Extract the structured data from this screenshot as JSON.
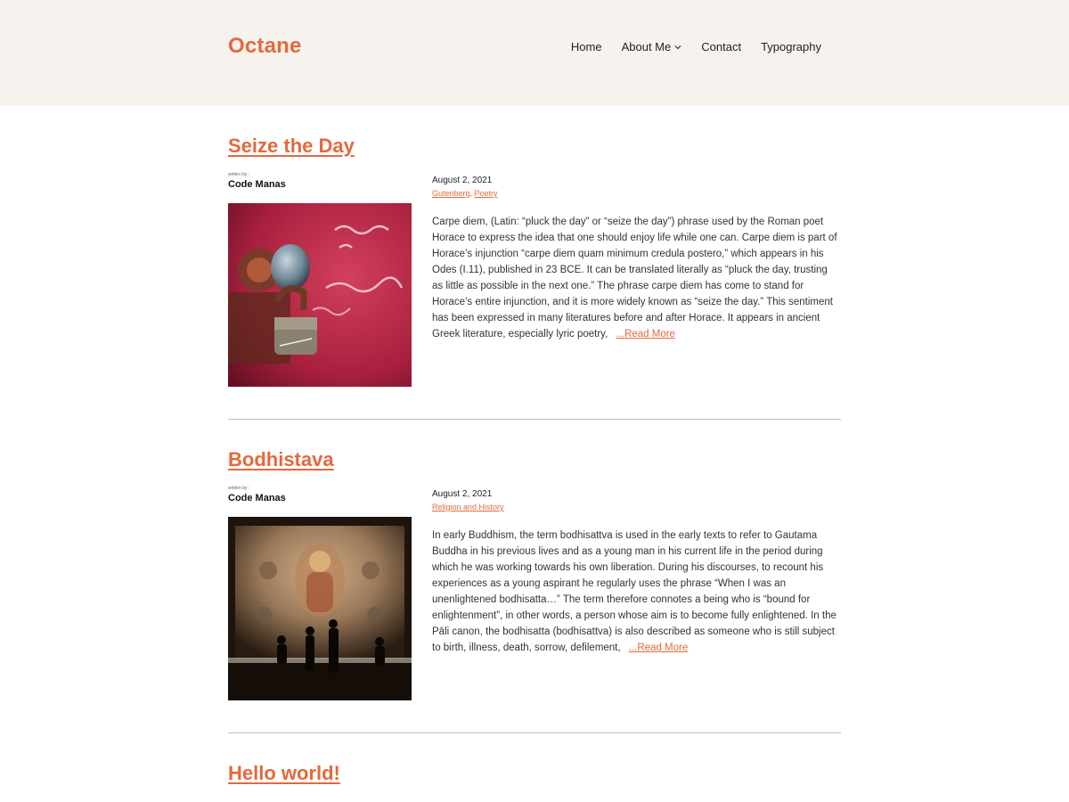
{
  "site": {
    "title": "Octane"
  },
  "nav": {
    "items": [
      {
        "label": "Home"
      },
      {
        "label": "About Me"
      },
      {
        "label": "Contact"
      },
      {
        "label": "Typography"
      }
    ]
  },
  "posts": [
    {
      "title": "Seize the Day",
      "written_by": "written by :",
      "author": "Code Manas",
      "date": "August 2, 2021",
      "categories": [
        "Gutenberg",
        "Poetry"
      ],
      "excerpt": "Carpe diem, (Latin: “pluck the day” or “seize the day”) phrase used by the Roman poet Horace to express the idea that one should enjoy life while one can. Carpe diem is part of Horace’s injunction “carpe diem quam minimum credula postero,” which appears in his Odes (I.11), published in 23 BCE. It can be translated literally as “pluck the day, trusting as little as possible in the next one.” The phrase carpe diem has come to stand for Horace’s entire injunction, and it is more widely known as “seize the day.” This sentiment has been expressed in many literatures before and after Horace. It appears in ancient Greek literature, especially lyric poetry,",
      "read_more": "...Read More"
    },
    {
      "title": "Bodhistava",
      "written_by": "written by :",
      "author": "Code Manas",
      "date": "August 2, 2021",
      "categories": [
        "Religion and History"
      ],
      "excerpt": "In early Buddhism, the term bodhisattva is used in the early texts to refer to Gautama Buddha in his previous lives and as a young man in his current life in the period during which he was working towards his own liberation. During his discourses, to recount his experiences as a young aspirant he regularly uses the phrase “When I was an unenlightened bodhisatta…” The term therefore connotes a being who is “bound for enlightenment”, in other words, a person whose aim is to become fully enlightened. In the Pāli canon, the bodhisatta (bodhisattva) is also described as someone who is still subject to birth, illness, death, sorrow, defilement,",
      "read_more": "...Read More"
    },
    {
      "title": "Hello world!"
    }
  ],
  "colors": {
    "accent": "#e4693b",
    "header_bg": "#f6f2ee",
    "divider": "#bdbdbd"
  }
}
